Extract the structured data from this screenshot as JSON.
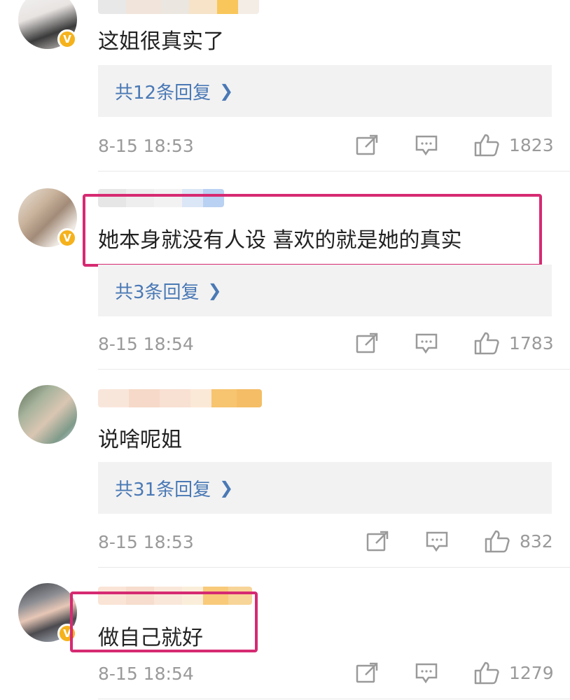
{
  "comments": [
    {
      "text": "这姐很真实了",
      "replies_label": "共12条回复",
      "time": "8-15 18:53",
      "likes": "1823",
      "highlighted": false
    },
    {
      "text": "她本身就没有人设 喜欢的就是她的真实",
      "replies_label": "共3条回复",
      "time": "8-15 18:54",
      "likes": "1783",
      "highlighted": true
    },
    {
      "text": "说啥呢姐",
      "replies_label": "共31条回复",
      "time": "8-15 18:53",
      "likes": "832",
      "highlighted": false
    },
    {
      "text": "做自己就好",
      "replies_label": "",
      "time": "8-15 18:54",
      "likes": "1279",
      "highlighted": true
    }
  ],
  "icons": {
    "share": "share-icon",
    "comment": "comment-icon",
    "like": "thumbs-up-icon",
    "verified": "verified-badge-icon",
    "chevron": "chevron-right-icon"
  },
  "colors": {
    "highlight": "#d62a72",
    "link": "#4a79b5",
    "meta": "#9a9a9a",
    "verified": "#f5b21c",
    "reply_bg": "#f2f2f2"
  }
}
